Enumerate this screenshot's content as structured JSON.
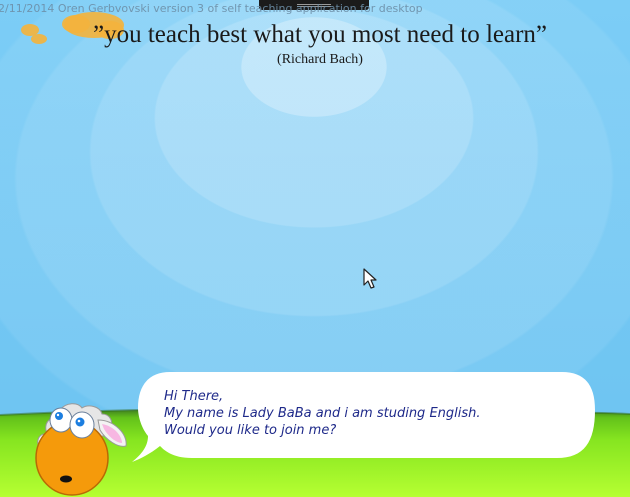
{
  "window": {
    "caption": "2/11/2014 Oren Gerbvovski version 3 of self teaching application for desktop"
  },
  "quote": {
    "text": "”you teach best what you most need to learn”",
    "author": "(Richard Bach)"
  },
  "character": {
    "name": "Lady BaBa",
    "speech": {
      "line1": "Hi There,",
      "line2": "My name is Lady BaBa and i am studing English.",
      "line3": "Would you like to join me?"
    }
  },
  "colors": {
    "sky": "#72c8f4",
    "grass": "#7ee31c",
    "grass_light": "#b6ff32",
    "sheep_body": "#f59a0b",
    "speech_text": "#1f2a8a",
    "bubble": "#ffffff"
  },
  "icons": {
    "cursor": "arrow-cursor-icon",
    "clouds": "cloud-icon",
    "character": "sheep-icon"
  }
}
